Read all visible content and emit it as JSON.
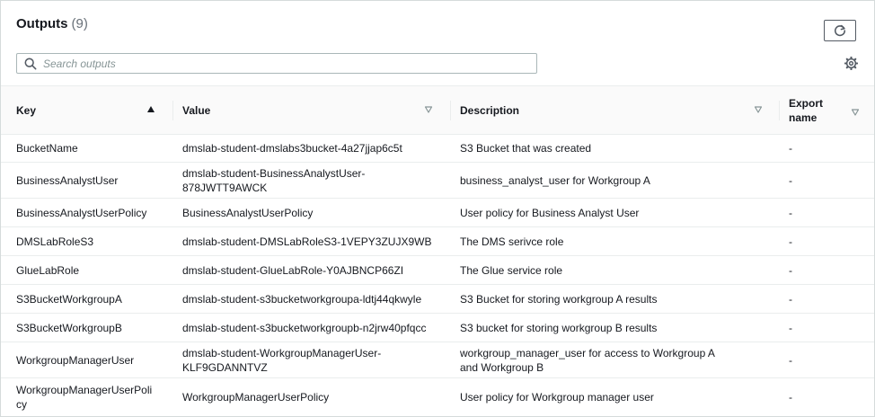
{
  "header": {
    "title": "Outputs",
    "count": "(9)"
  },
  "search": {
    "placeholder": "Search outputs"
  },
  "columns": {
    "key": "Key",
    "value": "Value",
    "description": "Description",
    "export_name": "Export name"
  },
  "rows": [
    {
      "key": "BucketName",
      "value": "dmslab-student-dmslabs3bucket-4a27jjap6c5t",
      "description": "S3 Bucket that was created",
      "export": "-"
    },
    {
      "key": "BusinessAnalystUser",
      "value": "dmslab-student-BusinessAnalystUser-878JWTT9AWCK",
      "description": "business_analyst_user for Workgroup A",
      "export": "-"
    },
    {
      "key": "BusinessAnalystUserPolicy",
      "value": "BusinessAnalystUserPolicy",
      "description": "User policy for Business Analyst User",
      "export": "-"
    },
    {
      "key": "DMSLabRoleS3",
      "value": "dmslab-student-DMSLabRoleS3-1VEPY3ZUJX9WB",
      "description": "The DMS serivce role",
      "export": "-"
    },
    {
      "key": "GlueLabRole",
      "value": "dmslab-student-GlueLabRole-Y0AJBNCP66ZI",
      "description": "The Glue service role",
      "export": "-"
    },
    {
      "key": "S3BucketWorkgroupA",
      "value": "dmslab-student-s3bucketworkgroupa-ldtj44qkwyle",
      "description": "S3 Bucket for storing workgroup A results",
      "export": "-"
    },
    {
      "key": "S3BucketWorkgroupB",
      "value": "dmslab-student-s3bucketworkgroupb-n2jrw40pfqcc",
      "description": "S3 bucket for storing workgroup B results",
      "export": "-"
    },
    {
      "key": "WorkgroupManagerUser",
      "value": "dmslab-student-WorkgroupManagerUser-KLF9GDANNTVZ",
      "description": "workgroup_manager_user for access to Workgroup A and Workgroup B",
      "export": "-"
    },
    {
      "key": "WorkgroupManagerUserPolicy",
      "value": "WorkgroupManagerUserPolicy",
      "description": "User policy for Workgroup manager user",
      "export": "-"
    }
  ],
  "icons": {
    "search": "search-icon",
    "refresh": "refresh-icon",
    "settings": "gear-icon",
    "sort_asc": "sort-ascending-icon",
    "sort_none": "sort-descending-outline-icon"
  },
  "colors": {
    "text": "#16191f",
    "muted": "#687078",
    "border": "#eaeded",
    "header_bg": "#fafafa"
  }
}
